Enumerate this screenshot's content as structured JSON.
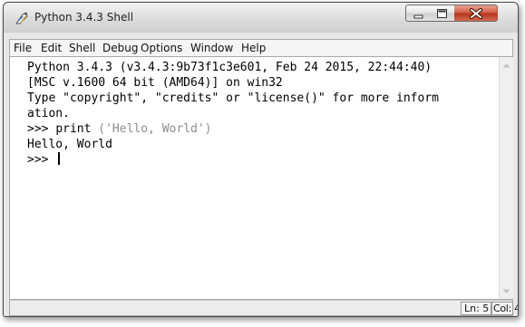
{
  "window": {
    "title": "Python 3.4.3 Shell",
    "icon": "python-idle-icon",
    "controls": [
      "minimize-icon",
      "maximize-icon",
      "close-icon"
    ]
  },
  "menu": {
    "items": [
      "File",
      "Edit",
      "Shell",
      "Debug",
      "Options",
      "Window",
      "Help"
    ]
  },
  "shell": {
    "lines": [
      "Python 3.4.3 (v3.4.3:9b73f1c3e601, Feb 24 2015, 22:44:40)",
      "[MSC v.1600 64 bit (AMD64)] on win32",
      "Type \"copyright\", \"credits\" or \"license()\" for more inform",
      "ation."
    ],
    "input_prompt": ">>> ",
    "input_code": "print ",
    "input_string": "('Hello, World')",
    "output": "Hello, World",
    "current_prompt": ">>> "
  },
  "status": {
    "line": "Ln: 5",
    "col": "Col: 4"
  },
  "colors": {
    "string": "#8c8c8c",
    "text": "#000000",
    "close_button": "#c9462e"
  }
}
